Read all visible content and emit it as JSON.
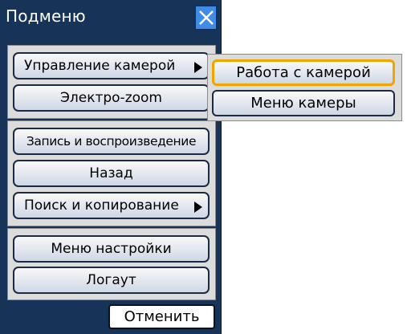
{
  "window": {
    "title": "Подменю",
    "close_icon": "close-icon"
  },
  "menu": {
    "section1": [
      {
        "label": "Управление камерой",
        "has_submenu": true,
        "highlighted": true
      },
      {
        "label": "Электро-zoom",
        "has_submenu": false
      }
    ],
    "section2": [
      {
        "label": "Запись и воспроизведение",
        "has_submenu": false
      },
      {
        "label": "Назад",
        "has_submenu": false
      },
      {
        "label": "Поиск и копирование",
        "has_submenu": true
      }
    ],
    "section3": [
      {
        "label": "Меню настройки",
        "has_submenu": false
      },
      {
        "label": "Логаут",
        "has_submenu": false
      }
    ]
  },
  "submenu": {
    "items": [
      {
        "label": "Работа с камерой",
        "selected": true
      },
      {
        "label": "Меню камеры",
        "selected": false
      }
    ]
  },
  "footer": {
    "cancel_label": "Отменить"
  },
  "colors": {
    "panel_bg": "#173458",
    "section_bg": "#dcdcdc",
    "close_button": "#3f8be6",
    "selection_outline": "#f0a400"
  }
}
